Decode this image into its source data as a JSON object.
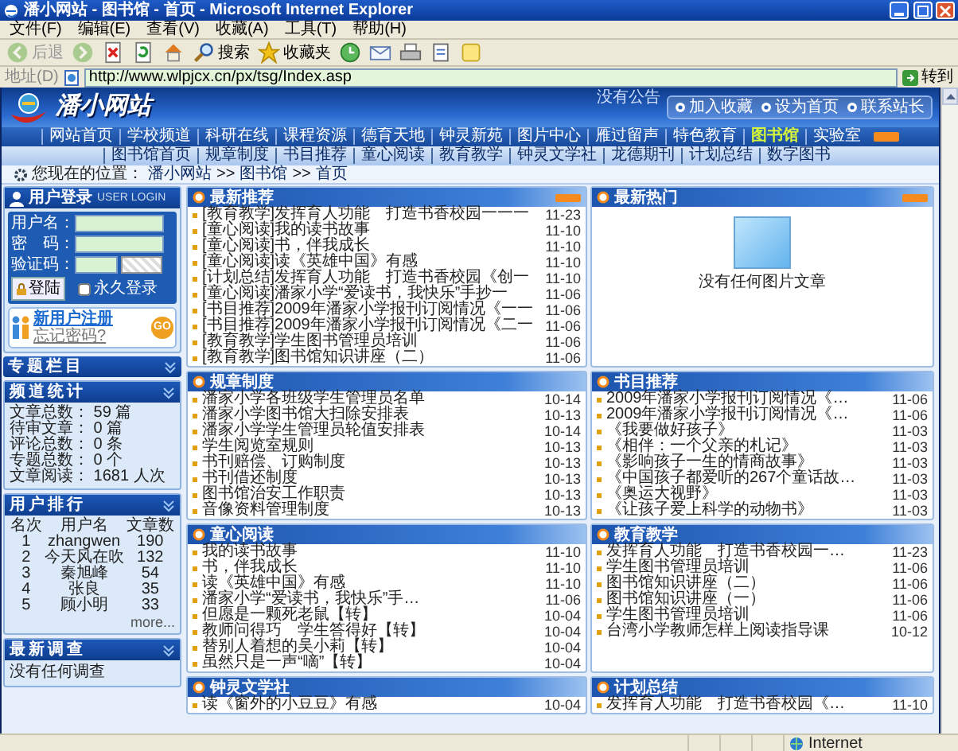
{
  "window": {
    "title": "潘小网站 - 图书馆 - 首页 - Microsoft Internet Explorer"
  },
  "menu": [
    "文件(F)",
    "编辑(E)",
    "查看(V)",
    "收藏(A)",
    "工具(T)",
    "帮助(H)"
  ],
  "toolbar": [
    {
      "kind": "back",
      "label": "后退",
      "disabled": true
    },
    {
      "kind": "forward",
      "disabled": true
    },
    {
      "kind": "stop",
      "disabled": false
    },
    {
      "kind": "refresh",
      "disabled": false
    },
    {
      "kind": "home",
      "disabled": false
    },
    {
      "kind": "search",
      "label": "搜索",
      "disabled": false
    },
    {
      "kind": "favorites",
      "label": "收藏夹",
      "disabled": false
    },
    {
      "kind": "history",
      "disabled": false
    },
    {
      "kind": "mail",
      "disabled": false
    },
    {
      "kind": "print",
      "disabled": false
    },
    {
      "kind": "edit",
      "disabled": false
    },
    {
      "kind": "note",
      "disabled": false
    }
  ],
  "address_bar": {
    "label": "地址(D)",
    "value": "http://www.wlpjcx.cn/px/tsg/Index.asp",
    "go": "转到"
  },
  "site": {
    "logo": "潘小网站",
    "notice": "没有公告",
    "quick_links": [
      "加入收藏",
      "设为首页",
      "联系站长"
    ],
    "nav": [
      {
        "label": "网站首页",
        "selected": false
      },
      {
        "label": "学校频道",
        "selected": false
      },
      {
        "label": "科研在线",
        "selected": false
      },
      {
        "label": "课程资源",
        "selected": false
      },
      {
        "label": "德育天地",
        "selected": false
      },
      {
        "label": "钟灵新苑",
        "selected": false
      },
      {
        "label": "图片中心",
        "selected": false
      },
      {
        "label": "雁过留声",
        "selected": false
      },
      {
        "label": "特色教育",
        "selected": false
      },
      {
        "label": "图书馆",
        "selected": true
      },
      {
        "label": "实验室",
        "selected": false
      }
    ],
    "subnav": [
      "图书馆首页",
      "规章制度",
      "书目推荐",
      "童心阅读",
      "教育教学",
      "钟灵文学社",
      "龙德期刊",
      "计划总结",
      "数字图书"
    ],
    "breadcrumb": {
      "label": "您现在的位置：",
      "items": [
        "潘小网站",
        "图书馆",
        "首页"
      ],
      "separators": [
        ">>",
        ">>"
      ]
    }
  },
  "login": {
    "title": "用户登录",
    "subtitle": "USER LOGIN",
    "fields": [
      {
        "label": "用户名："
      },
      {
        "label": "密　码："
      },
      {
        "label": "验证码："
      }
    ],
    "button": "登陆",
    "remember": {
      "label": "永久登录",
      "checked": false
    },
    "register": {
      "label": "新用户注册",
      "sublabel": "忘记密码?",
      "go": "GO"
    }
  },
  "sidebar_boxes": [
    {
      "kind": "empty",
      "title": "专题栏目"
    },
    {
      "kind": "stats",
      "title": "频道统计",
      "lines": [
        "文章总数： 59 篇",
        "待审文章： 0 篇",
        "评论总数： 0 条",
        "专题总数： 0 个",
        "文章阅读： 1681 人次"
      ]
    },
    {
      "kind": "ranking",
      "title": "用户排行",
      "columns": [
        "名次",
        "用户名",
        "文章数"
      ],
      "rows": [
        [
          "1",
          "zhangwen",
          "190"
        ],
        [
          "2",
          "今天风在吹",
          "132"
        ],
        [
          "3",
          "秦旭峰",
          "54"
        ],
        [
          "4",
          "张良",
          "35"
        ],
        [
          "5",
          "顾小明",
          "33"
        ]
      ],
      "more": "more..."
    },
    {
      "kind": "text",
      "title": "最新调查",
      "text": "没有任何调查"
    }
  ],
  "panels": [
    {
      "kind": "list",
      "title": "最新推荐",
      "more_badge": true,
      "items": [
        {
          "text": "[教育教学]发挥育人功能　打造书香校园一一一",
          "date": "11-23"
        },
        {
          "text": "[童心阅读]我的读书故事",
          "date": "11-10"
        },
        {
          "text": "[童心阅读]书，伴我成长",
          "date": "11-10"
        },
        {
          "text": "[童心阅读]读《英雄中国》有感",
          "date": "11-10"
        },
        {
          "text": "[计划总结]发挥育人功能　打造书香校园《创一",
          "date": "11-10"
        },
        {
          "text": "[童心阅读]潘家小学“爱读书，我快乐”手抄一",
          "date": "11-06"
        },
        {
          "text": "[书目推荐]2009年潘家小学报刊订阅情况《一一",
          "date": "11-06"
        },
        {
          "text": "[书目推荐]2009年潘家小学报刊订阅情况《二一",
          "date": "11-06"
        },
        {
          "text": "[教育教学]学生图书管理员培训",
          "date": "11-06"
        },
        {
          "text": "[教育教学]图书馆知识讲座（二）",
          "date": "11-06"
        }
      ]
    },
    {
      "kind": "picture",
      "title": "最新热门",
      "more_badge": true,
      "caption": "没有任何图片文章"
    },
    {
      "kind": "list",
      "title": "规章制度",
      "more_badge": false,
      "items": [
        {
          "text": "潘家小学各班级学生管理员名单",
          "date": "10-14"
        },
        {
          "text": "潘家小学图书馆大扫除安排表",
          "date": "10-13"
        },
        {
          "text": "潘家小学学生管理员轮值安排表",
          "date": "10-14"
        },
        {
          "text": "学生阅览室规则",
          "date": "10-13"
        },
        {
          "text": "书刊赔偿、订购制度",
          "date": "10-13"
        },
        {
          "text": "书刊借还制度",
          "date": "10-13"
        },
        {
          "text": "图书馆治安工作职责",
          "date": "10-13"
        },
        {
          "text": "音像资料管理制度",
          "date": "10-13"
        }
      ]
    },
    {
      "kind": "list",
      "title": "书目推荐",
      "more_badge": false,
      "items": [
        {
          "text": "2009年潘家小学报刊订阅情况《…",
          "date": "11-06"
        },
        {
          "text": "2009年潘家小学报刊订阅情况《…",
          "date": "11-06"
        },
        {
          "text": "《我要做好孩子》",
          "date": "11-03"
        },
        {
          "text": "《相伴：一个父亲的札记》",
          "date": "11-03"
        },
        {
          "text": "《影响孩子一生的情商故事》",
          "date": "11-03"
        },
        {
          "text": "《中国孩子都爱听的267个童话故…",
          "date": "11-03"
        },
        {
          "text": "《奥运大视野》",
          "date": "11-03"
        },
        {
          "text": "《让孩子爱上科学的动物书》",
          "date": "11-03"
        }
      ]
    },
    {
      "kind": "list",
      "title": "童心阅读",
      "more_badge": false,
      "items": [
        {
          "text": "我的读书故事",
          "date": "11-10"
        },
        {
          "text": "书，伴我成长",
          "date": "11-10"
        },
        {
          "text": "读《英雄中国》有感",
          "date": "11-10"
        },
        {
          "text": "潘家小学“爱读书，我快乐”手…",
          "date": "11-06"
        },
        {
          "text": "但愿是一颗死老鼠【转】",
          "date": "10-04"
        },
        {
          "text": "教师问得巧　学生答得好【转】",
          "date": "10-04"
        },
        {
          "text": "替别人着想的吴小莉【转】",
          "date": "10-04"
        },
        {
          "text": "虽然只是一声“嘀”【转】",
          "date": "10-04"
        }
      ]
    },
    {
      "kind": "list",
      "title": "教育教学",
      "more_badge": false,
      "items": [
        {
          "text": "发挥育人功能　打造书香校园一…",
          "date": "11-23"
        },
        {
          "text": "学生图书管理员培训",
          "date": "11-06"
        },
        {
          "text": "图书馆知识讲座（二）",
          "date": "11-06"
        },
        {
          "text": "图书馆知识讲座（一）",
          "date": "11-06"
        },
        {
          "text": "学生图书管理员培训",
          "date": "11-06"
        },
        {
          "text": "台湾小学教师怎样上阅读指导课",
          "date": "10-12"
        }
      ]
    },
    {
      "kind": "list",
      "title": "钟灵文学社",
      "more_badge": false,
      "items": [
        {
          "text": "读《窗外的小豆豆》有感",
          "date": "10-04"
        }
      ]
    },
    {
      "kind": "list",
      "title": "计划总结",
      "more_badge": false,
      "items": [
        {
          "text": "发挥育人功能　打造书香校园《…",
          "date": "11-10"
        }
      ]
    }
  ],
  "status_bar": {
    "zone": "Internet"
  }
}
